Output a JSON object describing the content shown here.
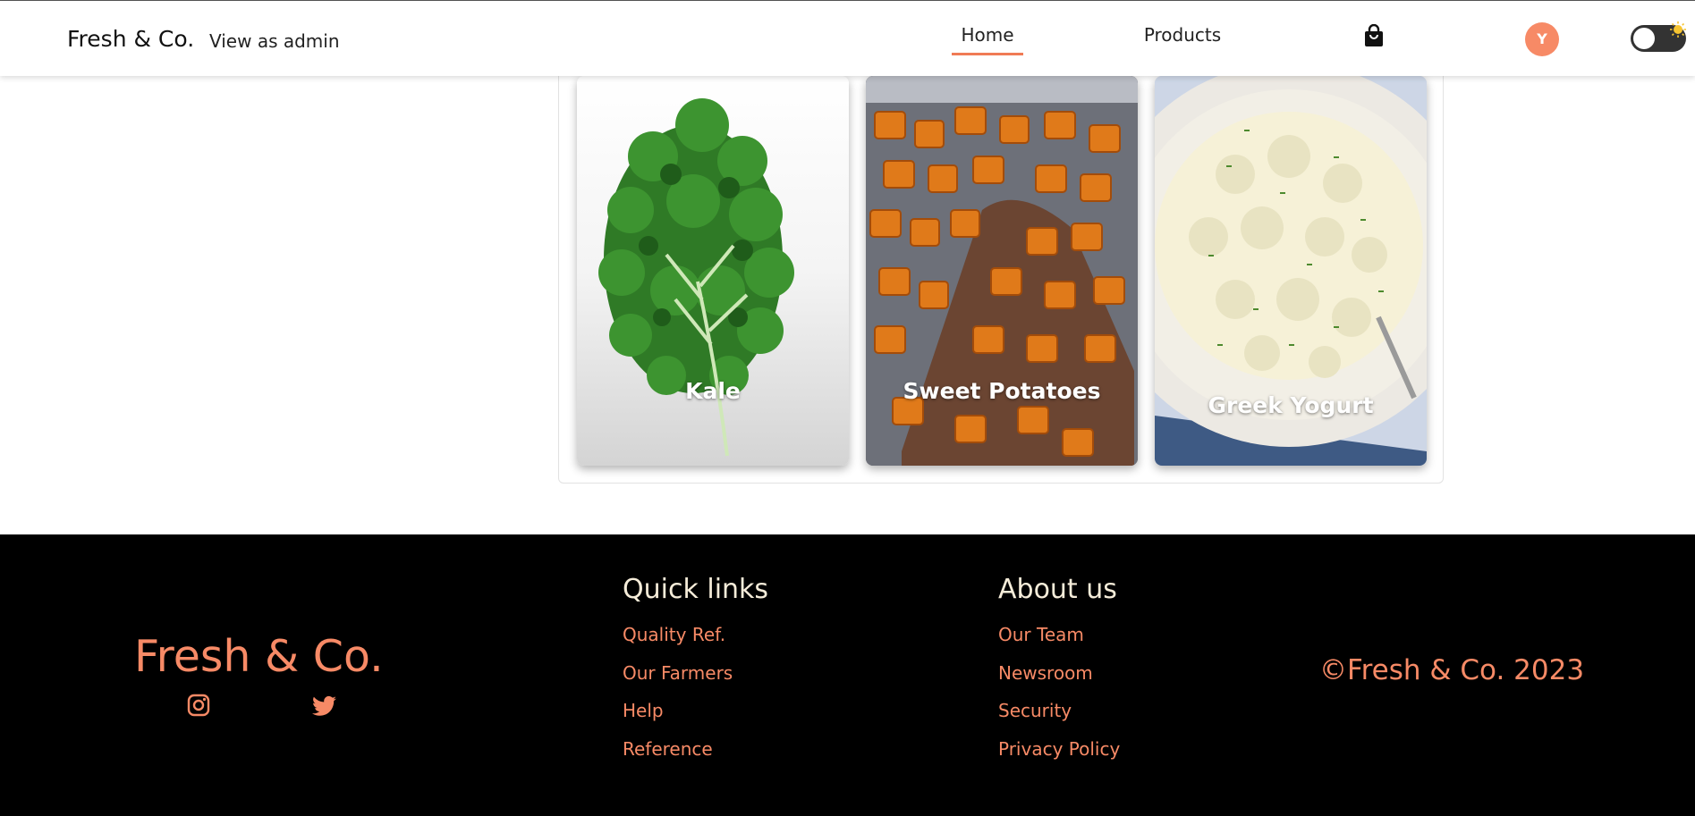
{
  "header": {
    "brand": "Fresh & Co.",
    "admin_link": "View as admin",
    "nav": {
      "home": "Home",
      "products": "Products"
    },
    "cart_icon": "shopping-bag-icon",
    "avatar_initial": "Y",
    "theme_toggle_icon": "sun-icon",
    "accent_color": "#f07b55"
  },
  "cards": [
    {
      "label": "Kale",
      "image": "kale-leaf"
    },
    {
      "label": "Sweet Potatoes",
      "image": "roasted-sweet-potatoes"
    },
    {
      "label": "Greek Yogurt",
      "image": "potato-salad-bowl"
    }
  ],
  "footer": {
    "brand": "Fresh & Co.",
    "social_icons": [
      "instagram-icon",
      "twitter-icon"
    ],
    "quick_links": {
      "title": "Quick links",
      "items": [
        "Quality Ref.",
        "Our Farmers",
        "Help",
        "Reference"
      ]
    },
    "about": {
      "title": "About us",
      "items": [
        "Our Team",
        "Newsroom",
        "Security",
        "Privacy Policy"
      ]
    },
    "copyright": "©Fresh & Co. 2023",
    "link_color": "#f78a66",
    "background": "#000000"
  }
}
